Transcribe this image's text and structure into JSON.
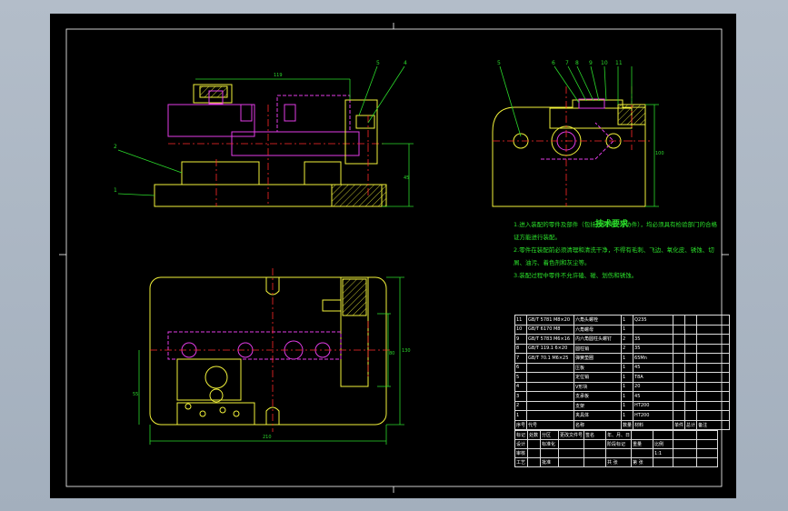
{
  "drawing": {
    "tech_title": "技术要求",
    "tech_notes": [
      "1.进入装配的零件及部件（包括外购件、外协件），均必须具有检验部门的合格",
      "证方能进行装配。",
      "2.零件在装配前必须清理和清洗干净，不得有毛刺、飞边、氧化皮、锈蚀、切",
      "屑、油污、着色剂和灰尘等。",
      "3.装配过程中零件不允许磕、碰、划伤和锈蚀。"
    ],
    "part_labels_front": [
      "5",
      "6",
      "7",
      "8",
      "9",
      "10",
      "11"
    ],
    "part_labels_side": [
      "5",
      "4"
    ],
    "part_labels_left": [
      "2",
      "1"
    ],
    "dims": {
      "top_len": "119",
      "side_h": "45",
      "plan_w": "210",
      "plan_h": "130",
      "plan_inner": "80",
      "plan_left": "55",
      "side_right": "100"
    },
    "bom_header": [
      "序号",
      "代号",
      "名称",
      "数量",
      "材料",
      "单件",
      "总计",
      "备注"
    ],
    "bom_rows": [
      [
        "11",
        "GB/T 5781 M8×20",
        "六角头螺栓",
        "1",
        "Q235",
        "",
        "",
        ""
      ],
      [
        "10",
        "GB/T 6170 M8",
        "六角螺母",
        "1",
        "",
        "",
        "",
        ""
      ],
      [
        "9",
        "GB/T 5783 M6×16",
        "内六角圆柱头螺钉",
        "2",
        "35",
        "",
        "",
        ""
      ],
      [
        "8",
        "GB/T 119.1 6×20",
        "圆柱销",
        "2",
        "35",
        "",
        "",
        ""
      ],
      [
        "7",
        "GB/T 70.1 M6×25",
        "弹簧垫圈",
        "1",
        "65Mn",
        "",
        "",
        ""
      ],
      [
        "6",
        "",
        "压板",
        "1",
        "45",
        "",
        "",
        ""
      ],
      [
        "5",
        "",
        "定位销",
        "1",
        "T8A",
        "",
        "",
        ""
      ],
      [
        "4",
        "",
        "V形块",
        "1",
        "20",
        "",
        "",
        ""
      ],
      [
        "3",
        "",
        "支承板",
        "1",
        "45",
        "",
        "",
        ""
      ],
      [
        "2",
        "",
        "支架",
        "1",
        "HT200",
        "",
        "",
        ""
      ],
      [
        "1",
        "",
        "夹具体",
        "1",
        "HT200",
        "",
        "",
        ""
      ]
    ],
    "title_block": {
      "r1": [
        "标记",
        "处数",
        "分区",
        "更改文件号",
        "签名",
        "年、月、日",
        "",
        "",
        "",
        ""
      ],
      "r2": [
        "设计",
        "",
        "标准化",
        "",
        "",
        "阶段标记",
        "重量",
        "比例",
        "",
        ""
      ],
      "r3": [
        "审核",
        "",
        "",
        "",
        "",
        "",
        "",
        "1:1",
        "",
        ""
      ],
      "r4": [
        "工艺",
        "",
        "批准",
        "",
        "",
        "共 张",
        "第 张",
        "",
        "",
        ""
      ]
    }
  }
}
